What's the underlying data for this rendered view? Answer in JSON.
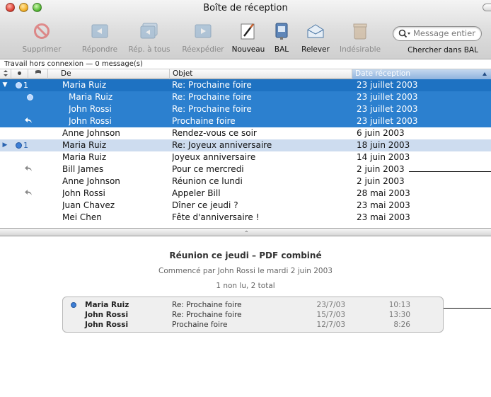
{
  "window": {
    "title": "Boîte de réception"
  },
  "toolbar": {
    "buttons": [
      {
        "label": "Supprimer",
        "icon": "delete-icon",
        "enabled": false
      },
      {
        "label": "Répondre",
        "icon": "reply-icon",
        "enabled": false
      },
      {
        "label": "Rép. à tous",
        "icon": "reply-all-icon",
        "enabled": false
      },
      {
        "label": "Réexpédier",
        "icon": "forward-icon",
        "enabled": false
      },
      {
        "label": "Nouveau",
        "icon": "compose-icon",
        "enabled": true
      },
      {
        "label": "BAL",
        "icon": "mailbox-icon",
        "enabled": true
      },
      {
        "label": "Relever",
        "icon": "get-mail-icon",
        "enabled": true
      },
      {
        "label": "Indésirable",
        "icon": "junk-icon",
        "enabled": false
      }
    ],
    "search": {
      "placeholder": "Message entier",
      "label": "Chercher dans BAL"
    }
  },
  "status": "Travail hors connexion — 0 message(s)",
  "columns": [
    "De",
    "Objet",
    "Date réception"
  ],
  "messages": [
    {
      "from": "Maria Ruiz",
      "subject": "Re: Prochaine foire",
      "date": "23 juillet 2003",
      "thread": "▼",
      "status": "1",
      "icon": "unread-dot",
      "state": "selected",
      "indent": false
    },
    {
      "from": "Maria Ruiz",
      "subject": "Re: Prochaine foire",
      "date": "23 juillet 2003",
      "thread": "",
      "status": "",
      "icon": "unread-dot",
      "state": "selected-child",
      "indent": true
    },
    {
      "from": "John Rossi",
      "subject": "Re: Prochaine foire",
      "date": "23 juillet 2003",
      "thread": "",
      "status": "",
      "icon": "",
      "state": "selected-child",
      "indent": true
    },
    {
      "from": "John Rossi",
      "subject": "Prochaine foire",
      "date": "23 juillet 2003",
      "thread": "",
      "status": "",
      "icon": "replied",
      "state": "selected-child",
      "indent": true
    },
    {
      "from": "Anne Johnson",
      "subject": "Rendez-vous ce soir",
      "date": "6 juin 2003",
      "thread": "",
      "status": "",
      "icon": "",
      "state": "",
      "indent": false
    },
    {
      "from": "Maria Ruiz",
      "subject": "Re: Joyeux anniversaire",
      "date": "18 juin 2003",
      "thread": "▶",
      "status": "1",
      "icon": "unread-dot",
      "state": "highlight",
      "indent": false
    },
    {
      "from": "Maria Ruiz",
      "subject": "Joyeux anniversaire",
      "date": "14 juin 2003",
      "thread": "",
      "status": "",
      "icon": "",
      "state": "",
      "indent": false
    },
    {
      "from": "Bill James",
      "subject": "Pour ce mercredi",
      "date": "2 juin 2003",
      "thread": "",
      "status": "",
      "icon": "replied",
      "state": "",
      "indent": false
    },
    {
      "from": "Anne Johnson",
      "subject": "Réunion ce lundi",
      "date": "2 juin 2003",
      "thread": "",
      "status": "",
      "icon": "",
      "state": "",
      "indent": false
    },
    {
      "from": "John Rossi",
      "subject": "Appeler Bill",
      "date": "28 mai 2003",
      "thread": "",
      "status": "",
      "icon": "replied",
      "state": "",
      "indent": false
    },
    {
      "from": "Juan Chavez",
      "subject": "Dîner ce jeudi ?",
      "date": "23 mai 2003",
      "thread": "",
      "status": "",
      "icon": "",
      "state": "",
      "indent": false
    },
    {
      "from": "Mei Chen",
      "subject": "Fête d'anniversaire !",
      "date": "23 mai 2003",
      "thread": "",
      "status": "",
      "icon": "",
      "state": "",
      "indent": false
    }
  ],
  "preview": {
    "title": "Réunion ce jeudi – PDF combiné",
    "subtitle": "Commencé par John Rossi le mardi 2 juin 2003",
    "count": "1 non lu, 2 total",
    "items": [
      {
        "from": "Maria Ruiz",
        "subject": "Re: Prochaine foire",
        "date": "23/7/03",
        "time": "10:13",
        "unread": true
      },
      {
        "from": "John Rossi",
        "subject": "Re: Prochaine foire",
        "date": "15/7/03",
        "time": "13:30",
        "unread": false
      },
      {
        "from": "John Rossi",
        "subject": "Prochaine foire",
        "date": "12/7/03",
        "time": "8:26",
        "unread": false
      }
    ]
  },
  "colors": {
    "selection": "#1e72c2",
    "highlight": "#cddcef",
    "unread": "#3d7ed5"
  }
}
